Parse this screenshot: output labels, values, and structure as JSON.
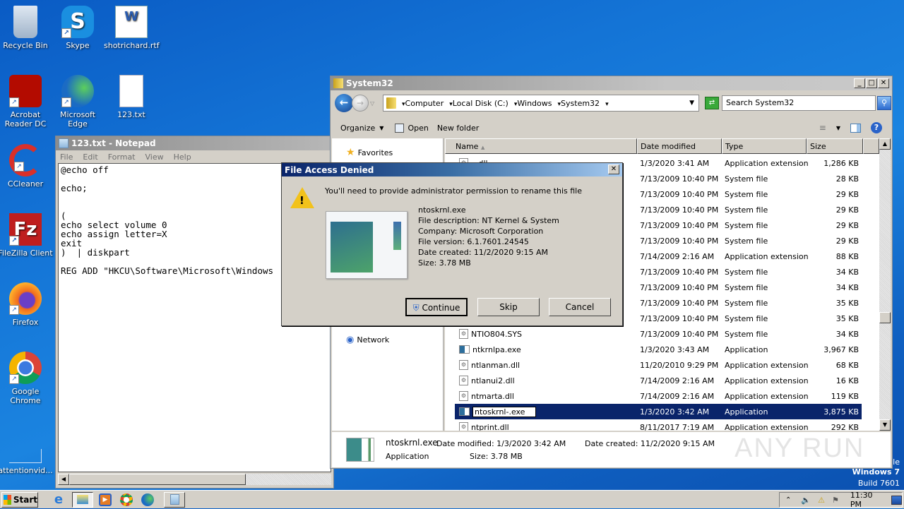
{
  "desktop": {
    "icons": [
      {
        "label": "Recycle Bin",
        "icon": "recycle-bin-icon"
      },
      {
        "label": "Skype",
        "icon": "skype-icon"
      },
      {
        "label": "shotrichard.rtf",
        "icon": "word-document-icon"
      },
      {
        "label": "Acrobat Reader DC",
        "icon": "acrobat-icon"
      },
      {
        "label": "Microsoft Edge",
        "icon": "edge-icon"
      },
      {
        "label": "123.txt",
        "icon": "text-file-icon"
      },
      {
        "label": "CCleaner",
        "icon": "ccleaner-icon"
      },
      {
        "label": "FileZilla Client",
        "icon": "filezilla-icon"
      },
      {
        "label": "Firefox",
        "icon": "firefox-icon"
      },
      {
        "label": "Google Chrome",
        "icon": "chrome-icon"
      },
      {
        "label": "attentionvid...",
        "icon": "file-icon"
      }
    ],
    "watermark": {
      "line1": "le",
      "line2": "Windows 7",
      "line3": "Build 7601"
    },
    "anyrun": "ANY RUN"
  },
  "notepad": {
    "title": "123.txt - Notepad",
    "menu": [
      "File",
      "Edit",
      "Format",
      "View",
      "Help"
    ],
    "content": "@echo off\n\necho;\n\n\n(\necho select volume 0\necho assign letter=X\nexit\n)  | diskpart\n\nREG ADD \"HKCU\\Software\\Microsoft\\Windows"
  },
  "explorer": {
    "title": "System32",
    "breadcrumb": [
      "Computer",
      "Local Disk (C:)",
      "Windows",
      "System32"
    ],
    "search_placeholder": "Search System32",
    "toolbar": {
      "organize": "Organize",
      "open": "Open",
      "new_folder": "New folder"
    },
    "nav": {
      "favorites": "Favorites",
      "network": "Network"
    },
    "columns": [
      "Name",
      "Date modified",
      "Type",
      "Size"
    ],
    "rows": [
      {
        "name": "...dll",
        "date": "1/3/2020 3:41 AM",
        "type": "Application extension",
        "size": "1,286 KB",
        "kind": "dll"
      },
      {
        "name": "",
        "date": "7/13/2009 10:40 PM",
        "type": "System file",
        "size": "28 KB",
        "kind": "sys"
      },
      {
        "name": "",
        "date": "7/13/2009 10:40 PM",
        "type": "System file",
        "size": "29 KB",
        "kind": "sys"
      },
      {
        "name": "",
        "date": "7/13/2009 10:40 PM",
        "type": "System file",
        "size": "29 KB",
        "kind": "sys"
      },
      {
        "name": "",
        "date": "7/13/2009 10:40 PM",
        "type": "System file",
        "size": "29 KB",
        "kind": "sys"
      },
      {
        "name": "",
        "date": "7/13/2009 10:40 PM",
        "type": "System file",
        "size": "29 KB",
        "kind": "sys"
      },
      {
        "name": "",
        "date": "7/14/2009 2:16 AM",
        "type": "Application extension",
        "size": "88 KB",
        "kind": "dll"
      },
      {
        "name": "",
        "date": "7/13/2009 10:40 PM",
        "type": "System file",
        "size": "34 KB",
        "kind": "sys"
      },
      {
        "name": "",
        "date": "7/13/2009 10:40 PM",
        "type": "System file",
        "size": "34 KB",
        "kind": "sys"
      },
      {
        "name": "",
        "date": "7/13/2009 10:40 PM",
        "type": "System file",
        "size": "35 KB",
        "kind": "sys"
      },
      {
        "name": "",
        "date": "7/13/2009 10:40 PM",
        "type": "System file",
        "size": "35 KB",
        "kind": "sys"
      },
      {
        "name": "NTIO804.SYS",
        "date": "7/13/2009 10:40 PM",
        "type": "System file",
        "size": "34 KB",
        "kind": "sys"
      },
      {
        "name": "ntkrnlpa.exe",
        "date": "1/3/2020 3:43 AM",
        "type": "Application",
        "size": "3,967 KB",
        "kind": "app"
      },
      {
        "name": "ntlanman.dll",
        "date": "11/20/2010 9:29 PM",
        "type": "Application extension",
        "size": "68 KB",
        "kind": "dll"
      },
      {
        "name": "ntlanui2.dll",
        "date": "7/14/2009 2:16 AM",
        "type": "Application extension",
        "size": "16 KB",
        "kind": "dll"
      },
      {
        "name": "ntmarta.dll",
        "date": "7/14/2009 2:16 AM",
        "type": "Application extension",
        "size": "119 KB",
        "kind": "dll"
      },
      {
        "name": "ntoskrnl-.exe",
        "date": "1/3/2020 3:42 AM",
        "type": "Application",
        "size": "3,875 KB",
        "kind": "app",
        "selected": true
      },
      {
        "name": "ntprint.dll",
        "date": "8/11/2017 7:19 AM",
        "type": "Application extension",
        "size": "292 KB",
        "kind": "dll"
      }
    ],
    "details": {
      "filename": "ntoskrnl.exe",
      "date_modified": "Date modified: 1/3/2020 3:42 AM",
      "date_created": "Date created: 11/2/2020 9:15 AM",
      "type": "Application",
      "size": "Size: 3.78 MB"
    }
  },
  "dialog": {
    "title": "File Access Denied",
    "message": "You'll need to provide administrator permission to rename this file",
    "info": [
      "ntoskrnl.exe",
      "File description: NT Kernel & System",
      "Company: Microsoft Corporation",
      "File version: 6.1.7601.24545",
      "Date created: 11/2/2020 9:15 AM",
      "Size: 3.78 MB"
    ],
    "buttons": {
      "continue": "Continue",
      "skip": "Skip",
      "cancel": "Cancel"
    }
  },
  "taskbar": {
    "start": "Start",
    "apps": [
      "internet-explorer",
      "file-explorer",
      "media-player",
      "chrome",
      "edge",
      "notepad"
    ],
    "clock": "11:30 PM"
  }
}
